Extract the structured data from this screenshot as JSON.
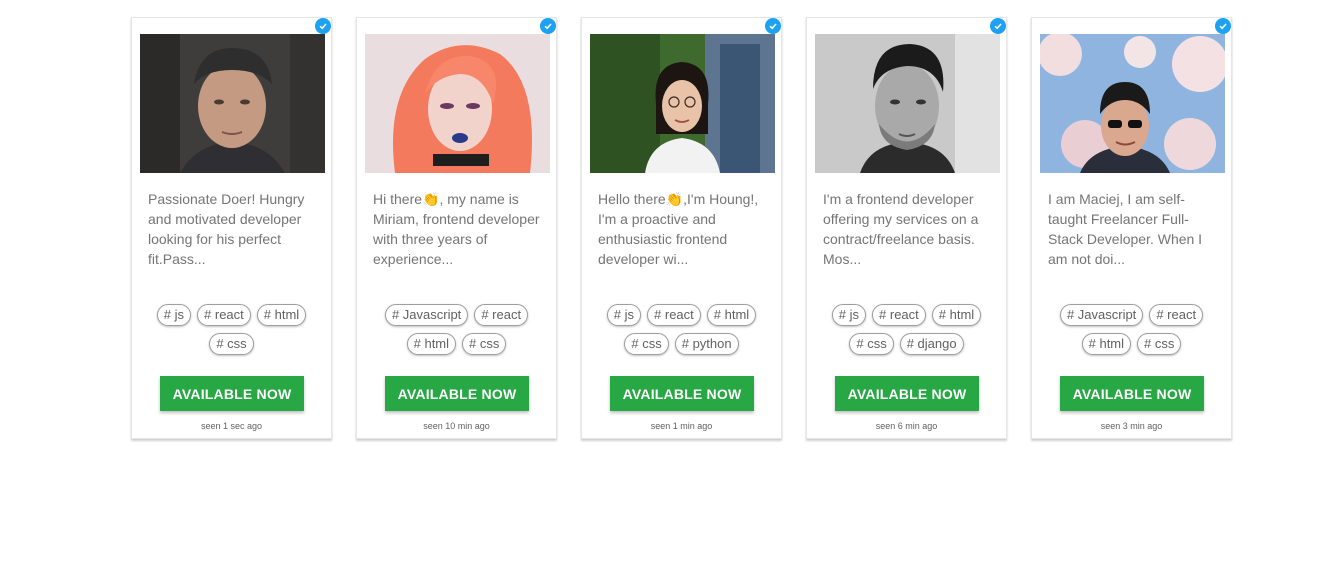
{
  "cards": [
    {
      "bio": "Passionate Doer! Hungry and motivated developer looking for his perfect fit.Pass...",
      "tags": [
        "# js",
        "# react",
        "# html",
        "# css"
      ],
      "cta": "AVAILABLE NOW",
      "seen": "seen 1 sec ago"
    },
    {
      "bio": "Hi there👏, my name is Miriam, frontend developer with three years of experience...",
      "tags": [
        "# Javascript",
        "# react",
        "# html",
        "# css"
      ],
      "cta": "AVAILABLE NOW",
      "seen": "seen 10 min ago"
    },
    {
      "bio": "Hello there👏,I'm Houng!, I'm a proactive and enthusiastic frontend developer wi...",
      "tags": [
        "# js",
        "# react",
        "# html",
        "# css",
        "# python"
      ],
      "cta": "AVAILABLE NOW",
      "seen": "seen 1 min ago"
    },
    {
      "bio": "I'm a frontend developer offering my services on a contract/freelance basis. Mos...",
      "tags": [
        "# js",
        "# react",
        "# html",
        "# css",
        "# django"
      ],
      "cta": "AVAILABLE NOW",
      "seen": "seen 6 min ago"
    },
    {
      "bio": "I am Maciej, I am self-taught Freelancer Full-Stack Developer. When I am not doi...",
      "tags": [
        "# Javascript",
        "# react",
        "# html",
        "# css"
      ],
      "cta": "AVAILABLE NOW",
      "seen": "seen 3 min ago"
    }
  ],
  "colors": {
    "cta": "#28a745",
    "verified": "#1da1f2"
  }
}
